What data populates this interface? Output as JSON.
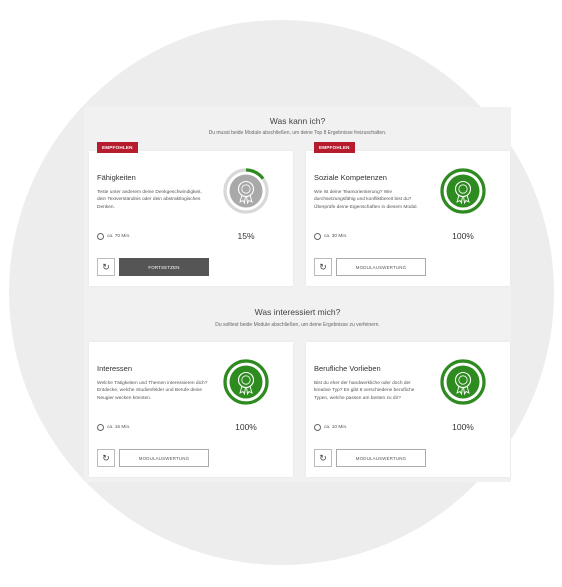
{
  "section1": {
    "title": "Was kann ich?",
    "subtitle": "Du musst beide Module abschließen, um deine Top 8 Ergebnisse freizuschalten."
  },
  "section2": {
    "title": "Was interessiert mich?",
    "subtitle": "Du solltest beide Module abschließen, um deine Ergebnisse zu verfeinern."
  },
  "cards": [
    {
      "badge": "EMPFOHLEN",
      "title": "Fähigkeiten",
      "description": "Teste unter anderem deine Denkgeschwindigkeit, dein Textverständnis oder dein abstraktlogisches Denken.",
      "duration": "ca. 70 Min.",
      "progress": "15%",
      "progress_value": 15,
      "action_label": "FORTSETZEN",
      "action_style": "dark",
      "completed": false
    },
    {
      "badge": "EMPFOHLEN",
      "title": "Soziale Kompetenzen",
      "description": "Wie ist deine Teamorientierung? Wie durchsetzungsfähig und konfliktbereit bist du? Überprüfe deine Eigenschaften in diesem Modul.",
      "duration": "ca. 30 Min.",
      "progress": "100%",
      "progress_value": 100,
      "action_label": "MODULAUSWERTUNG",
      "action_style": "light",
      "completed": true
    },
    {
      "title": "Interessen",
      "description": "Welche Tätigkeiten und Themen interessieren dich? Entdecke, welche Studienfelder und Berufe deine Neugier wecken könnten.",
      "duration": "ca. 15 Min.",
      "progress": "100%",
      "progress_value": 100,
      "action_label": "MODULAUSWERTUNG",
      "action_style": "light",
      "completed": true
    },
    {
      "title": "Berufliche Vorlieben",
      "description": "Bist du eher der handwerkliche oder doch der kreative Typ? Es gibt 8 verschiedene berufliche Typen, welche passen am besten zu dir?",
      "duration": "ca. 10 Min.",
      "progress": "100%",
      "progress_value": 100,
      "action_label": "MODULAUSWERTUNG",
      "action_style": "light",
      "completed": true
    }
  ],
  "colors": {
    "badge": "#b71c2e",
    "complete": "#2e8b1f",
    "incomplete": "#a9a9a9",
    "button_dark": "#555555"
  },
  "icons": {
    "reset": "reset-icon",
    "clock": "clock-icon",
    "award": "award-rosette-icon"
  }
}
